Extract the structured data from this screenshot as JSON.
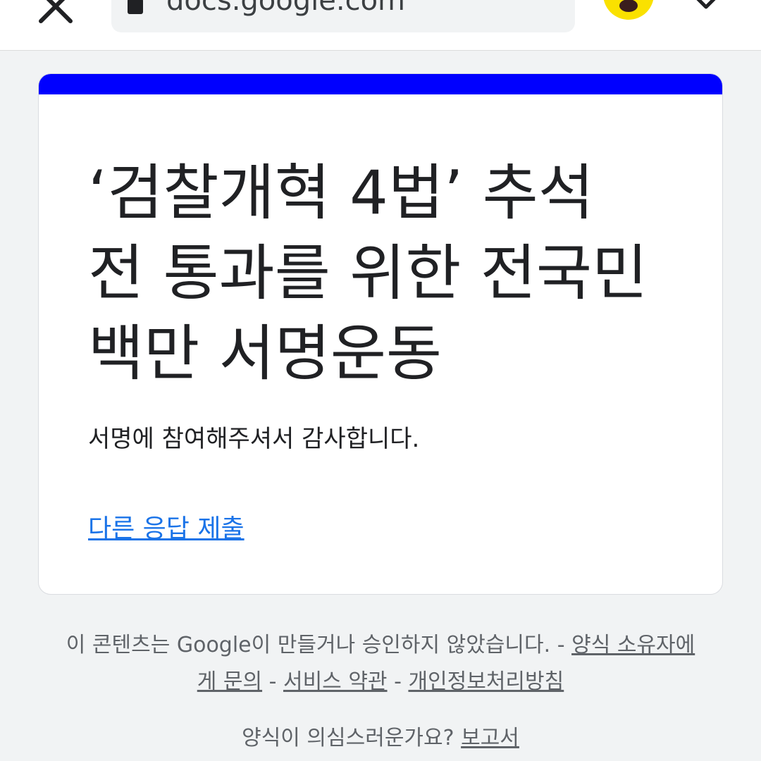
{
  "browser": {
    "url": "docs.google.com",
    "colors": {
      "kakao_button": "#fae100",
      "toolbar_bg": "#ffffff",
      "urlbar_bg": "#f1f3f4"
    },
    "icons": [
      "close-icon",
      "lock-icon",
      "kakaotalk-share-icon",
      "chevron-down-icon"
    ]
  },
  "card": {
    "accent_color": "#0000ff",
    "title": "‘검찰개혁 4법’ 추석 전 통과를 위한 전국민 백만 서명운동",
    "confirmation": "서명에 참여해주셔서 감사합니다.",
    "submit_another_link": "다른 응답 제출"
  },
  "footer": {
    "disclaimer": "이 콘텐츠는 Google이 만들거나 승인하지 않았습니다.",
    "sep1": " - ",
    "contact_owner_link": "양식 소유자에게 문의",
    "sep2": " - ",
    "terms_link": "서비스 약관",
    "sep3": " - ",
    "privacy_link": "개인정보처리방침",
    "suspicious_text": "양식이 의심스러운가요? ",
    "report_link": "보고서"
  }
}
